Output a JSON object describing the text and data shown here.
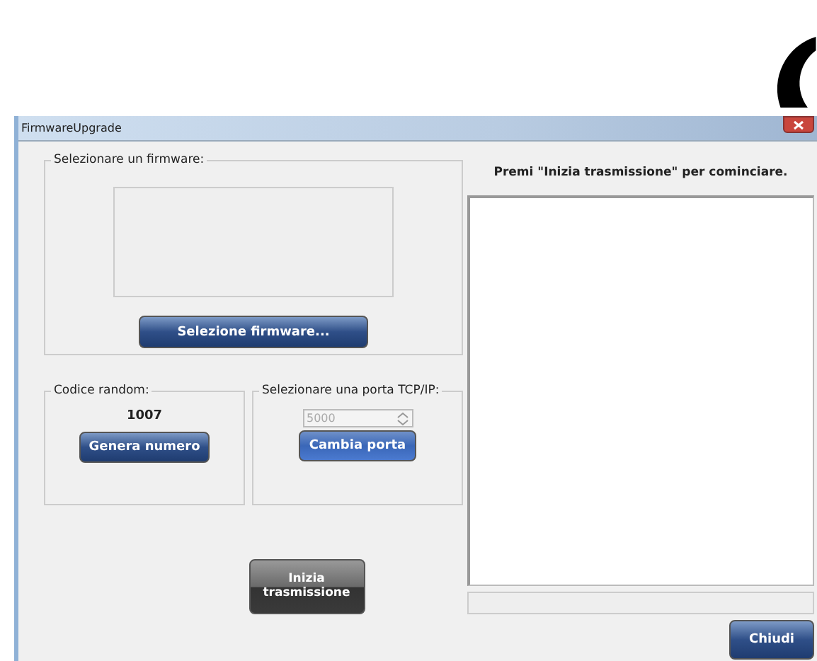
{
  "window": {
    "title": "FirmwareUpgrade"
  },
  "firmware_group": {
    "title": "Selezionare un firmware:",
    "button": "Selezione firmware..."
  },
  "random_group": {
    "title": "Codice random:",
    "value": "1007",
    "button": "Genera numero"
  },
  "port_group": {
    "title": "Selezionare una porta TCP/IP:",
    "port": {
      "value": "5000",
      "disabled": true
    },
    "button": "Cambia porta"
  },
  "start_button": "Inizia trasmissione",
  "instruction": "Premi \"Inizia trasmissione\" per cominciare.",
  "progress": {
    "level": 0
  },
  "close_button": "Chiudi"
}
